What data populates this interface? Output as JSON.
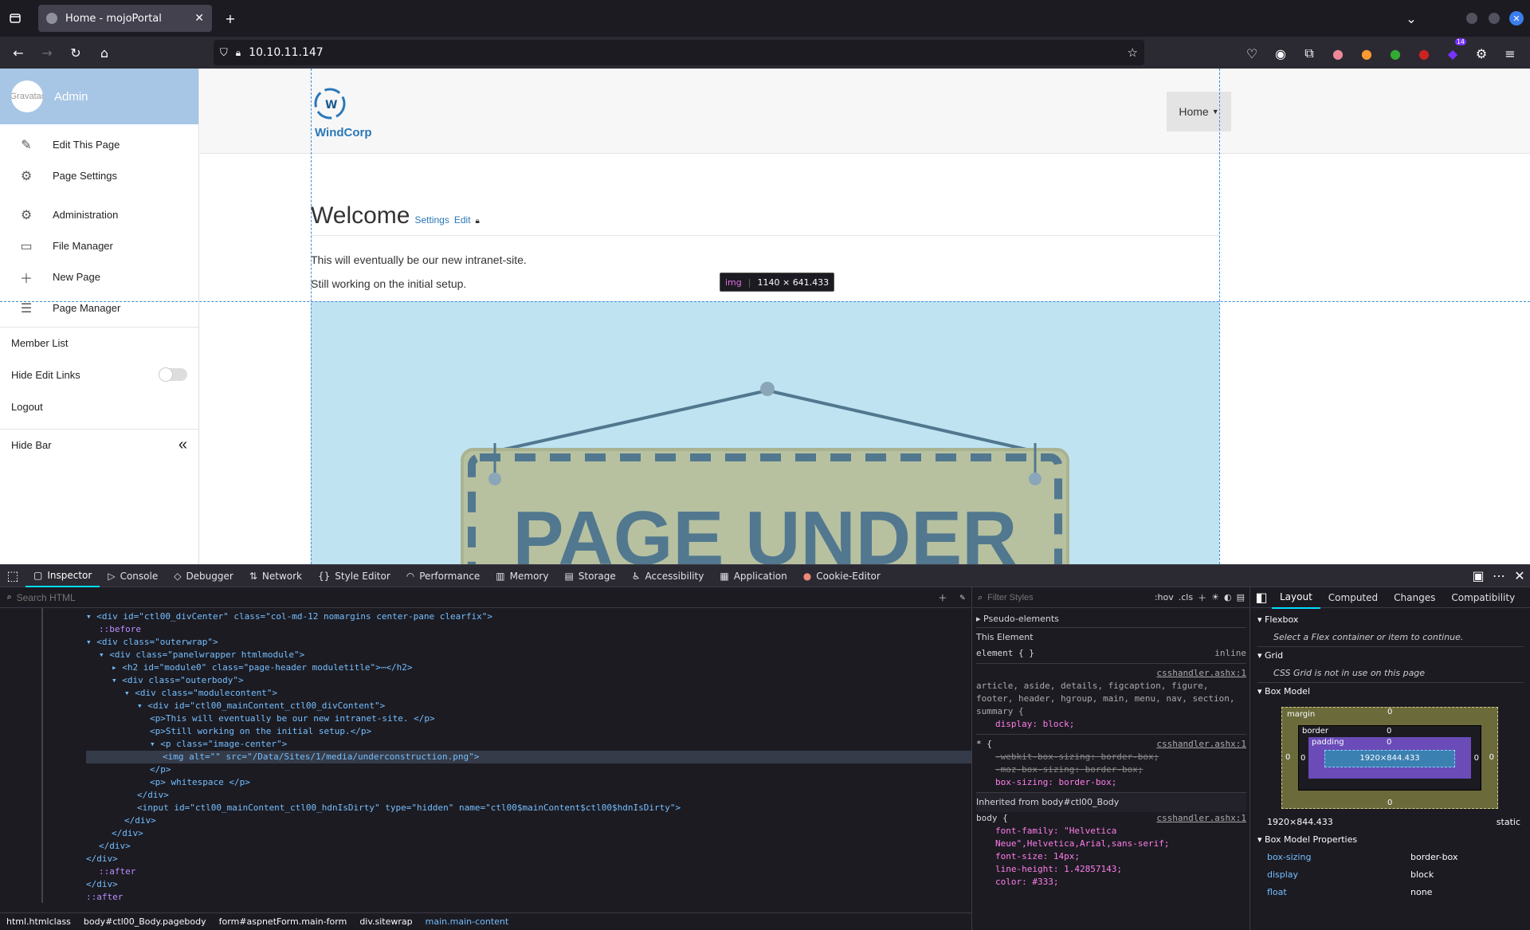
{
  "browser": {
    "tab_title": "Home - mojoPortal",
    "url": "10.10.11.147",
    "ext_badge": "14",
    "icons": [
      "tab-list-icon",
      "close-icon",
      "plus-icon",
      "chevron-down-icon",
      "back-icon",
      "forward-icon",
      "reload-icon",
      "home-icon",
      "shield-icon",
      "lock-icon",
      "star-icon",
      "pocket-icon",
      "account-icon",
      "extensions-icon",
      "menu-icon"
    ]
  },
  "sidebar": {
    "avatar_alt": "Gravatar",
    "user": "Admin",
    "items": [
      {
        "label": "Edit This Page",
        "icon": "wrench-icon"
      },
      {
        "label": "Page Settings",
        "icon": "file-gear-icon"
      },
      {
        "label": "Administration",
        "icon": "gears-icon"
      },
      {
        "label": "File Manager",
        "icon": "folder-icon"
      },
      {
        "label": "New Page",
        "icon": "file-plus-icon"
      },
      {
        "label": "Page Manager",
        "icon": "file-list-icon"
      }
    ],
    "member_list": "Member List",
    "hide_edit_links": "Hide Edit Links",
    "logout": "Logout",
    "hide_bar": "Hide Bar"
  },
  "site": {
    "logo_letter": "W",
    "logo_text": "WindCorp",
    "nav_home": "Home",
    "heading": "Welcome",
    "settings_link": "Settings",
    "edit_link": "Edit",
    "p1": "This will eventually be our new intranet-site.",
    "p2": "Still working on the initial setup.",
    "sign_text": "PAGE UNDER",
    "tooltip_tag": "img",
    "tooltip_size": "1140 × 641.433"
  },
  "devtools": {
    "tabs": [
      "Inspector",
      "Console",
      "Debugger",
      "Network",
      "Style Editor",
      "Performance",
      "Memory",
      "Storage",
      "Accessibility",
      "Application",
      "Cookie-Editor"
    ],
    "search_placeholder": "Search HTML",
    "filter_placeholder": "Filter Styles",
    "hov": ":hov",
    "cls": ".cls",
    "right_tabs": [
      "Layout",
      "Computed",
      "Changes",
      "Compatibility"
    ],
    "html_lines": [
      {
        "indent": 1,
        "t": "▾ <div id=\"ctl00_divCenter\" class=\"col-md-12 nomargins center-pane clearfix\">"
      },
      {
        "indent": 2,
        "t": "::before"
      },
      {
        "indent": 1,
        "t": "▾ <div class=\"outerwrap\">"
      },
      {
        "indent": 2,
        "t": "▾ <div class=\"panelwrapper htmlmodule\">"
      },
      {
        "indent": 3,
        "t": "▸ <h2 id=\"module0\" class=\"page-header moduletitle\">⋯</h2>"
      },
      {
        "indent": 3,
        "t": "▾ <div class=\"outerbody\">"
      },
      {
        "indent": 4,
        "t": "▾ <div class=\"modulecontent\">"
      },
      {
        "indent": 5,
        "t": "▾ <div id=\"ctl00_mainContent_ctl00_divContent\">"
      },
      {
        "indent": 6,
        "t": "<p>This will eventually be our new intranet-site. </p>"
      },
      {
        "indent": 6,
        "t": "<p>Still working on the initial setup.</p>"
      },
      {
        "indent": 6,
        "t": "▾ <p class=\"image-center\">"
      },
      {
        "indent": 7,
        "t": "<img alt=\"\" src=\"/Data/Sites/1/media/underconstruction.png\">"
      },
      {
        "indent": 6,
        "t": "</p>"
      },
      {
        "indent": 6,
        "t": "<p> whitespace </p>"
      },
      {
        "indent": 5,
        "t": "</div>"
      },
      {
        "indent": 5,
        "t": "<input id=\"ctl00_mainContent_ctl00_hdnIsDirty\" type=\"hidden\" name=\"ctl00$mainContent$ctl00$hdnIsDirty\">"
      },
      {
        "indent": 4,
        "t": "</div>"
      },
      {
        "indent": 3,
        "t": "</div>"
      },
      {
        "indent": 2,
        "t": "</div>"
      },
      {
        "indent": 1,
        "t": "</div>"
      },
      {
        "indent": 2,
        "t": "::after"
      },
      {
        "indent": 1,
        "t": "</div>"
      },
      {
        "indent": 1,
        "t": "::after"
      }
    ],
    "breadcrumb": [
      "html.htmlclass",
      "body#ctl00_Body.pagebody",
      "form#aspnetForm.main-form",
      "div.sitewrap",
      "main.main-content"
    ],
    "rules": {
      "pseudo": "Pseudo-elements",
      "this_element": "This Element",
      "element_rule": "element { }",
      "inline": "inline",
      "src": "csshandler.ashx:1",
      "selectors1": "article, aside, details, figcaption, figure, footer, header, hgroup, main, menu, nav, section, summary {",
      "decl1": "display: block;",
      "sel2": "* {",
      "decl2a": "-webkit-box-sizing: border-box;",
      "decl2b": "-moz-box-sizing: border-box;",
      "decl2c": "box-sizing: border-box;",
      "inherited": "Inherited from body#ctl00_Body",
      "sel3": "body {",
      "decl3a": "font-family: \"Helvetica Neue\",Helvetica,Arial,sans-serif;",
      "decl3b": "font-size: 14px;",
      "decl3c": "line-height: 1.42857143;",
      "decl3d": "color: #333;"
    },
    "layout": {
      "flexbox": "Flexbox",
      "flex_msg": "Select a Flex container or item to continue.",
      "grid": "Grid",
      "grid_msg": "CSS Grid is not in use on this page",
      "boxmodel": "Box Model",
      "margin": "margin",
      "border": "border",
      "padding": "padding",
      "content": "1920×844.433",
      "zero": "0",
      "size": "1920×844.433",
      "position": "static",
      "props_title": "Box Model Properties",
      "props": [
        {
          "k": "box-sizing",
          "v": "border-box"
        },
        {
          "k": "display",
          "v": "block"
        },
        {
          "k": "float",
          "v": "none"
        }
      ]
    }
  }
}
